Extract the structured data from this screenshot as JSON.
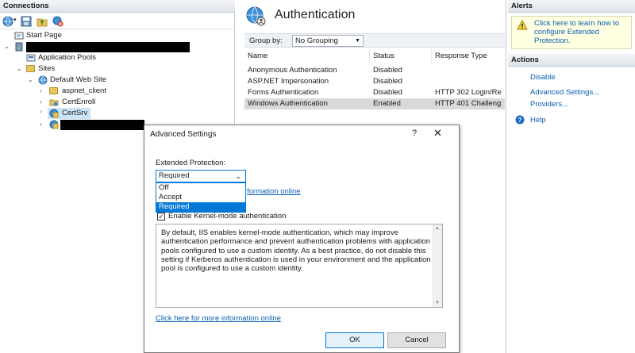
{
  "connections": {
    "header": "Connections",
    "tree": [
      {
        "label": "Start Page"
      },
      {
        "label": ""
      },
      {
        "label": "Application Pools"
      },
      {
        "label": "Sites"
      },
      {
        "label": "Default Web Site"
      },
      {
        "label": "aspnet_client"
      },
      {
        "label": "CertEnroll"
      },
      {
        "label": "CertSrv"
      },
      {
        "label": ""
      }
    ]
  },
  "center": {
    "title": "Authentication",
    "group_by_label": "Group by:",
    "group_by_value": "No Grouping",
    "columns": [
      "Name",
      "Status",
      "Response Type"
    ],
    "rows": [
      {
        "name": "Anonymous Authentication",
        "status": "Disabled",
        "response": ""
      },
      {
        "name": "ASP.NET Impersonation",
        "status": "Disabled",
        "response": ""
      },
      {
        "name": "Forms Authentication",
        "status": "Disabled",
        "response": "HTTP 302 Login/Re"
      },
      {
        "name": "Windows Authentication",
        "status": "Enabled",
        "response": "HTTP 401 Challeng"
      }
    ]
  },
  "right": {
    "alerts_header": "Alerts",
    "alert_text": "Click here to learn how to configure Extended Protection.",
    "actions_header": "Actions",
    "actions": [
      "Disable",
      "Advanced Settings...",
      "Providers...",
      "Help"
    ]
  },
  "dialog": {
    "title": "Advanced Settings",
    "help_glyph": "?",
    "close_glyph": "✕",
    "extended_label": "Extended Protection:",
    "selected_value": "Required",
    "options": [
      "Off",
      "Accept",
      "Required"
    ],
    "info_link_partial": "formation online",
    "kernel_label": "Enable Kernel-mode authentication",
    "kernel_checked": true,
    "description": "By default, IIS enables kernel-mode authentication, which may improve authentication performance and prevent authentication problems with application pools configured to use a custom identity. As a best practice, do not disable this setting if Kerberos authentication is used in your environment and the application pool is configured to use a custom identity.",
    "info_link": "Click here for more information online",
    "ok_label": "OK",
    "cancel_label": "Cancel"
  },
  "colors": {
    "link": "#0b5fb4",
    "selection": "#0078d7",
    "alert_bg": "#ffffe1"
  }
}
